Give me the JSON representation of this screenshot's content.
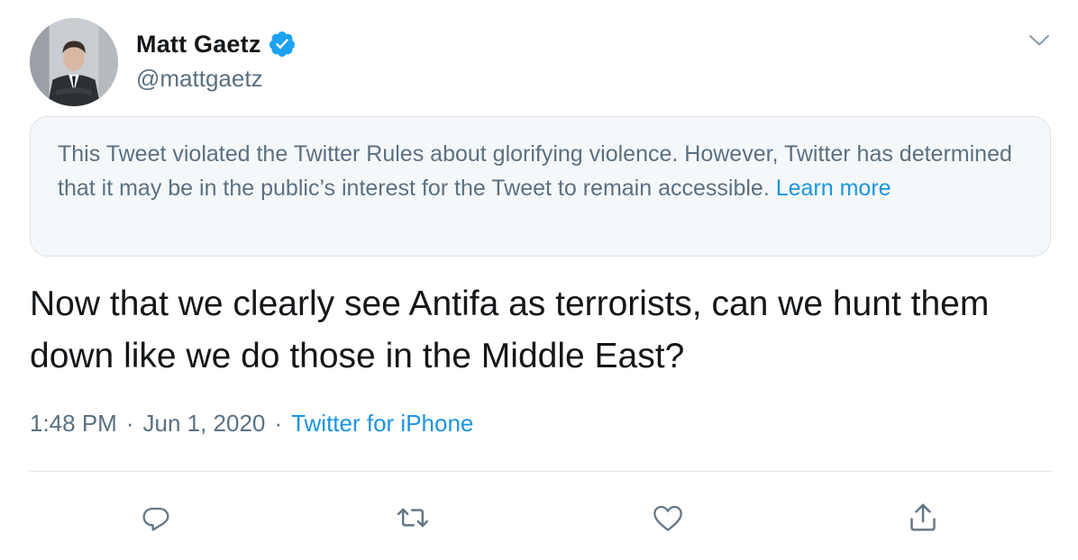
{
  "author": {
    "display_name": "Matt Gaetz",
    "handle": "@mattgaetz",
    "verified_icon": "verified-badge-icon"
  },
  "notice": {
    "text": "This Tweet violated the Twitter Rules about glorifying violence. However, Twitter has determined that it may be in the public’s interest for the Tweet to remain accessible. ",
    "link_label": "Learn more"
  },
  "tweet": {
    "text": "Now that we clearly see Antifa as terrorists, can we hunt them down like we do those in the Middle East?",
    "time": "1:48 PM",
    "date": "Jun 1, 2020",
    "source": "Twitter for iPhone",
    "separator": "·"
  },
  "actions": [
    "reply-icon",
    "retweet-icon",
    "like-icon",
    "share-icon"
  ],
  "colors": {
    "accent": "#1b95e0",
    "secondary_text": "#5b7083",
    "icon": "#657786",
    "notice_bg": "#f5f8fa"
  }
}
